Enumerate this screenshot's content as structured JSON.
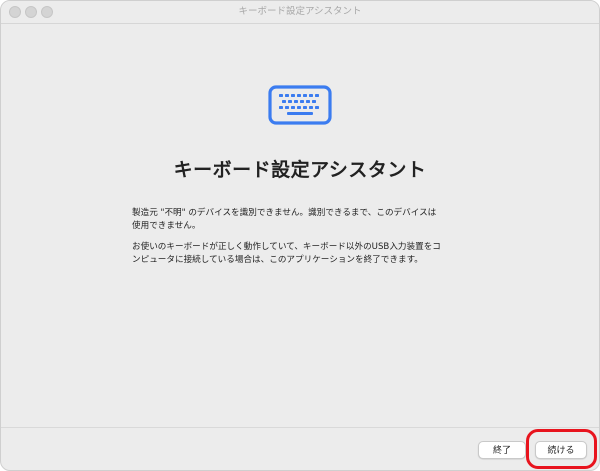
{
  "window": {
    "title": "キーボード設定アシスタント"
  },
  "main": {
    "icon": "keyboard-icon",
    "heading": "キーボード設定アシスタント",
    "paragraph1_line1": "製造元 \"不明\" のデバイスを識別できません。識別できるまで、このデバイスは",
    "paragraph1_line2": "使用できません。",
    "paragraph2_line1": "お使いのキーボードが正しく動作していて、キーボード以外のUSB入力装置をコ",
    "paragraph2_line2": "ンピュータに接続している場合は、このアプリケーションを終了できます。"
  },
  "footer": {
    "quit_label": "終了",
    "continue_label": "続ける"
  },
  "colors": {
    "accent": "#3b7cf0",
    "highlight": "#e8141e",
    "window_bg": "#ececec"
  }
}
